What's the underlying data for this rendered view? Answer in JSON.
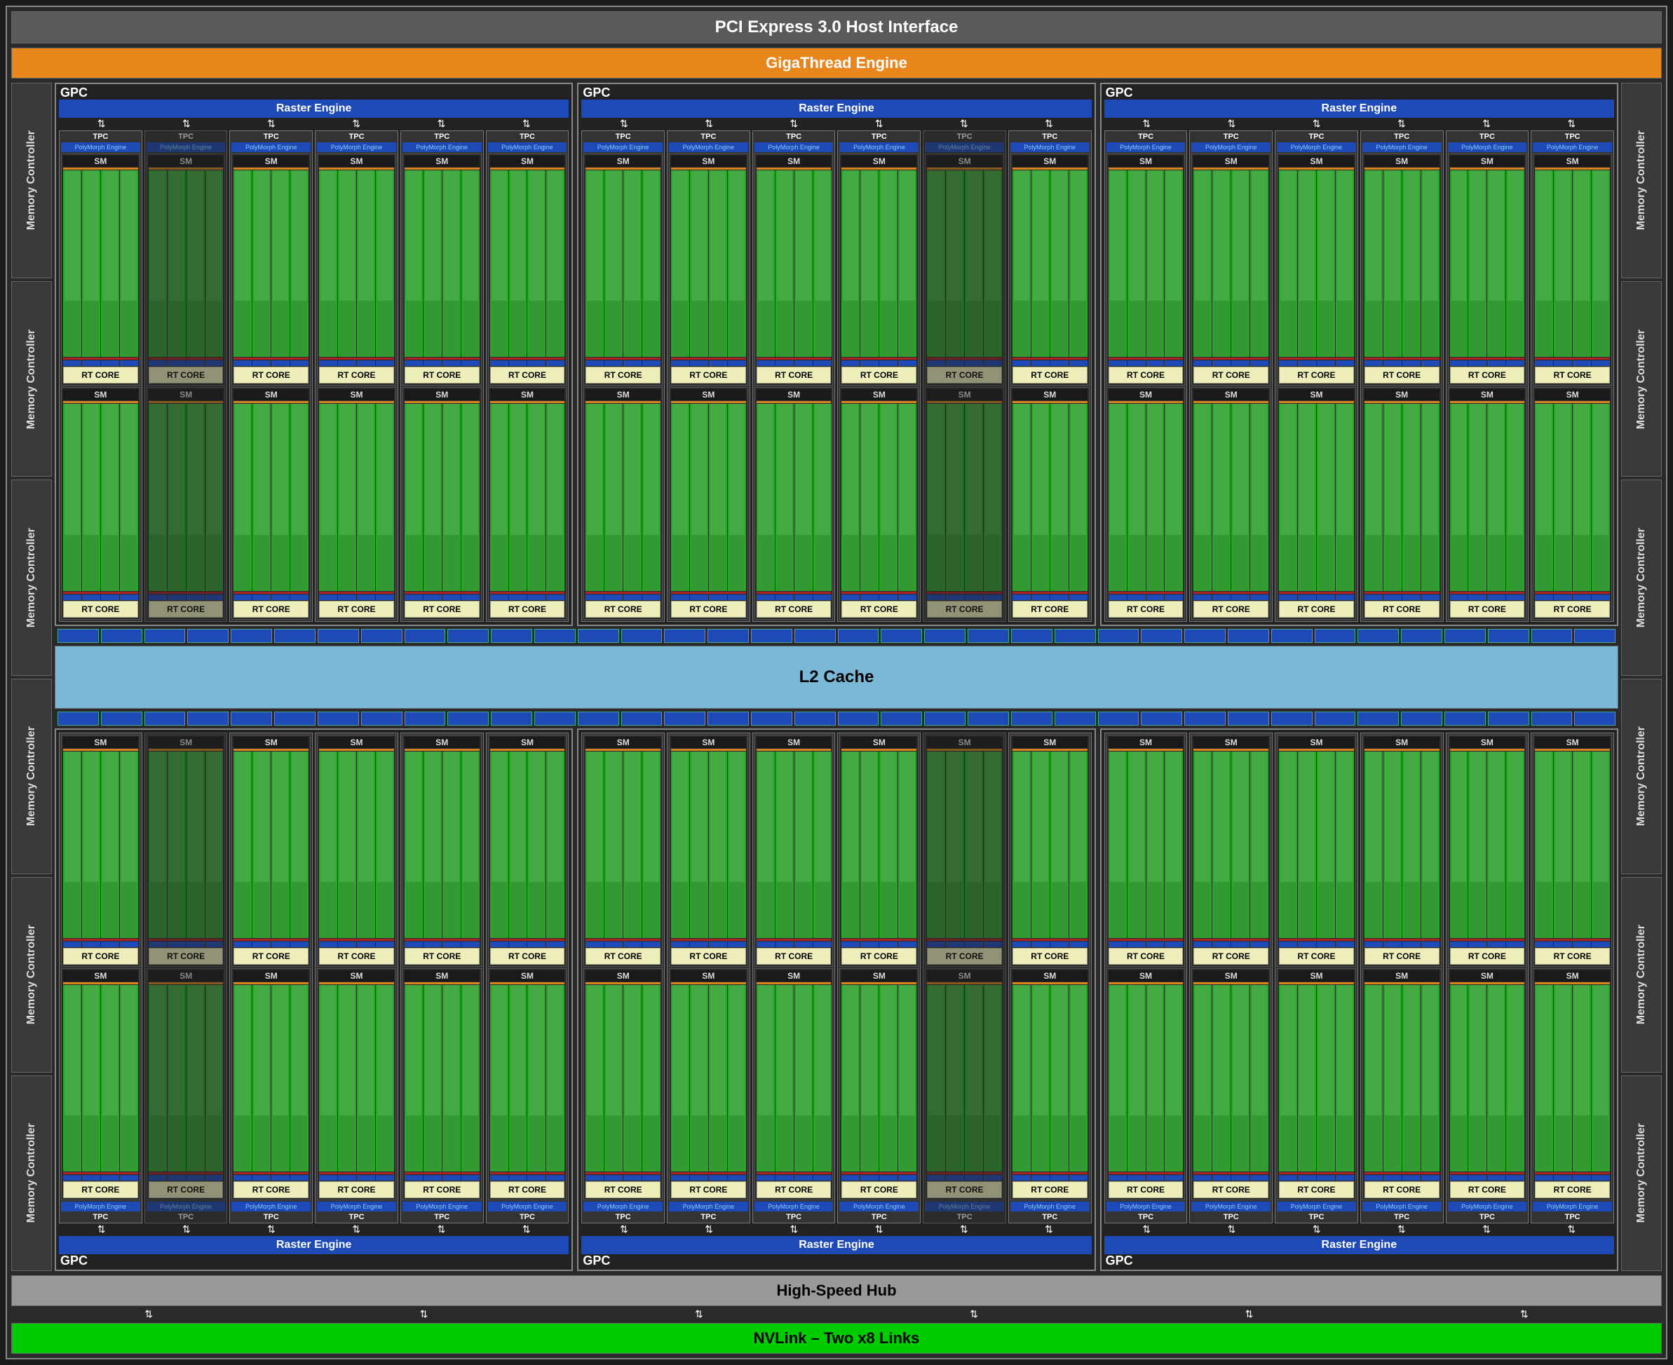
{
  "pci": "PCI Express 3.0 Host Interface",
  "gt": "GigaThread Engine",
  "l2": "L2 Cache",
  "hs": "High-Speed Hub",
  "nv": "NVLink – Two x8 Links",
  "mc": "Memory Controller",
  "gpc": "GPC",
  "raster": "Raster Engine",
  "tpc": "TPC",
  "poly": "PolyMorph Engine",
  "sm": "SM",
  "rt": "RT CORE",
  "layout": {
    "gpc_rows": 2,
    "gpcs_per_row": 3,
    "tpcs_per_gpc": 6,
    "sms_per_tpc": 2,
    "mc_per_side": 6,
    "rob_segments": 36,
    "faded_tpcs": [
      [
        0,
        0,
        1
      ],
      [
        0,
        1,
        4
      ],
      [
        1,
        0,
        1
      ],
      [
        1,
        1,
        4
      ]
    ],
    "detail_cell": [
      0,
      0,
      0
    ]
  },
  "colors": {
    "pci": "#5a5a5a",
    "gt": "#e8861c",
    "raster": "#1e4ab8",
    "l2": "#7ab8d8",
    "rt": "#ffee99",
    "nv": "#00cc00",
    "cores": "#44aa44",
    "mc": "#3a3a3a"
  }
}
